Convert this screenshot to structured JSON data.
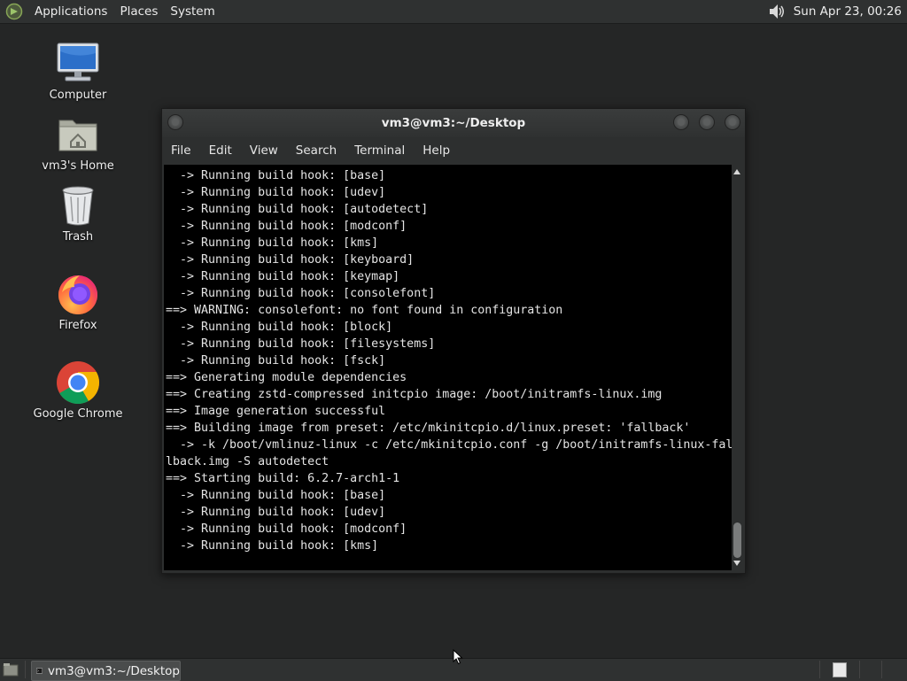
{
  "top_panel": {
    "menus": [
      "Applications",
      "Places",
      "System"
    ],
    "clock": "Sun Apr 23, 00:26"
  },
  "desktop_icons": [
    {
      "label": "Computer",
      "icon": "computer-icon"
    },
    {
      "label": "vm3's Home",
      "icon": "home-folder-icon"
    },
    {
      "label": "Trash",
      "icon": "trash-icon"
    },
    {
      "label": "Firefox",
      "icon": "firefox-icon"
    },
    {
      "label": "Google Chrome",
      "icon": "chrome-icon"
    }
  ],
  "terminal": {
    "title": "vm3@vm3:~/Desktop",
    "menu": [
      "File",
      "Edit",
      "View",
      "Search",
      "Terminal",
      "Help"
    ],
    "lines": [
      "  -> Running build hook: [base]",
      "  -> Running build hook: [udev]",
      "  -> Running build hook: [autodetect]",
      "  -> Running build hook: [modconf]",
      "  -> Running build hook: [kms]",
      "  -> Running build hook: [keyboard]",
      "  -> Running build hook: [keymap]",
      "  -> Running build hook: [consolefont]",
      "==> WARNING: consolefont: no font found in configuration",
      "  -> Running build hook: [block]",
      "  -> Running build hook: [filesystems]",
      "  -> Running build hook: [fsck]",
      "==> Generating module dependencies",
      "==> Creating zstd-compressed initcpio image: /boot/initramfs-linux.img",
      "==> Image generation successful",
      "==> Building image from preset: /etc/mkinitcpio.d/linux.preset: 'fallback'",
      "  -> -k /boot/vmlinuz-linux -c /etc/mkinitcpio.conf -g /boot/initramfs-linux-fal",
      "lback.img -S autodetect",
      "==> Starting build: 6.2.7-arch1-1",
      "  -> Running build hook: [base]",
      "  -> Running build hook: [udev]",
      "  -> Running build hook: [modconf]",
      "  -> Running build hook: [kms]"
    ]
  },
  "bottom_panel": {
    "task_label": "vm3@vm3:~/Desktop"
  },
  "colors": {
    "desktop_bg": "#252626",
    "panel_bg": "#2f3131",
    "terminal_bg": "#000000",
    "terminal_fg": "#e4e4e4"
  }
}
